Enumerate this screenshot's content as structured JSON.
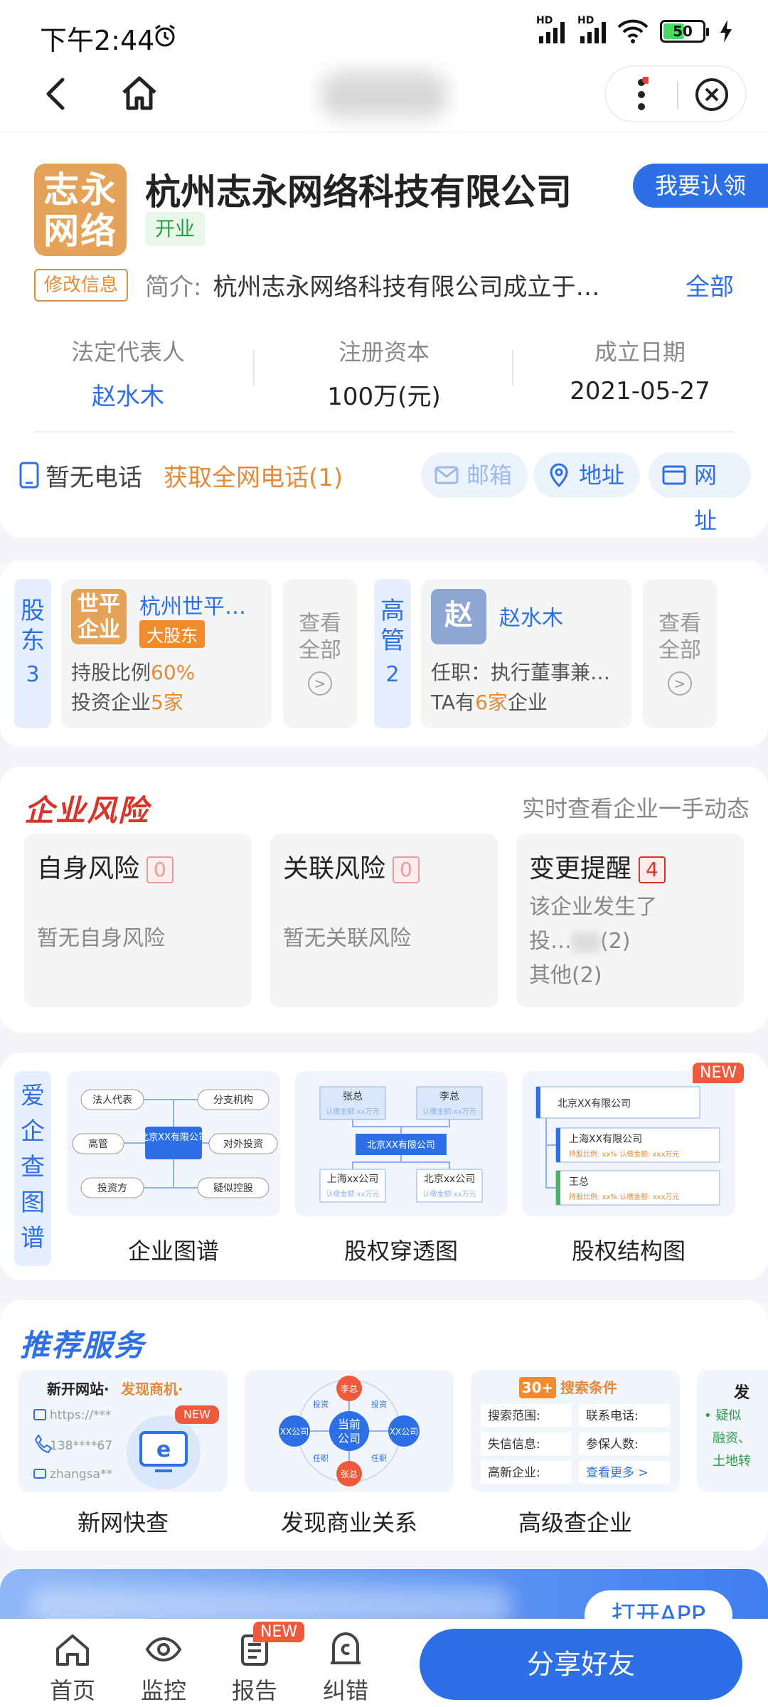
{
  "status_bar": {
    "time": "下午2:44",
    "sim1": "HD",
    "sim2": "HD",
    "battery": "50"
  },
  "company": {
    "logo_line1": "志永",
    "logo_line2": "网络",
    "name": "杭州志永网络科技有限公司",
    "status": "开业",
    "claim_label": "我要认领",
    "edit_label": "修改信息",
    "intro_label": "简介:",
    "intro_text": "杭州志永网络科技有限公司成立于…",
    "intro_all": "全部"
  },
  "key_info": [
    {
      "label": "法定代表人",
      "value": "赵水木"
    },
    {
      "label": "注册资本",
      "value": "100万(元)"
    },
    {
      "label": "成立日期",
      "value": "2021-05-27"
    }
  ],
  "contact": {
    "no_phone": "暂无电话",
    "get_phone": "获取全网电话(1)",
    "email": "邮箱",
    "address": "地址",
    "website": "网址"
  },
  "shareholders": {
    "label_top": "股",
    "label_bottom": "东",
    "count": "3",
    "avatar_line1": "世平",
    "avatar_line2": "企业",
    "name": "杭州世平…",
    "tag": "大股东",
    "ratio_label": "持股比例",
    "ratio_value": "60%",
    "invest_label": "投资企业",
    "invest_value": "5家",
    "view_all_1": "查看",
    "view_all_2": "全部"
  },
  "executives": {
    "label_top": "高",
    "label_bottom": "管",
    "count": "2",
    "avatar": "赵",
    "name": "赵水木",
    "role": "任职：执行董事兼…",
    "ta_prefix": "TA有",
    "ta_value": "6家",
    "ta_suffix": "企业",
    "view_all_1": "查看",
    "view_all_2": "全部"
  },
  "risk": {
    "title": "企业风险",
    "subtitle": "实时查看企业一手动态",
    "items": [
      {
        "title": "自身风险",
        "count": "0",
        "desc": "暂无自身风险"
      },
      {
        "title": "关联风险",
        "count": "0",
        "desc": "暂无关联风险"
      },
      {
        "title": "变更提醒",
        "count": "4",
        "line1": "该企业发生了",
        "line2a": "投…",
        "line2b": "(2)",
        "line3": "其他(2)"
      }
    ]
  },
  "graphs": {
    "label": [
      "爱",
      "企",
      "查",
      "图",
      "谱"
    ],
    "items": [
      {
        "title": "企业图谱",
        "center": "北京XX有限公司",
        "nodes": [
          "法人代表",
          "分支机构",
          "高管",
          "对外投资",
          "投资方",
          "疑似控股"
        ]
      },
      {
        "title": "股权穿透图",
        "top1": "张总",
        "top2": "李总",
        "sub": "认缴金额:xx万元",
        "center": "北京XX有限公司",
        "bottom1": "上海xx公司",
        "bottom2": "北京xx公司"
      },
      {
        "title": "股权结构图",
        "new": "NEW",
        "row1": "北京XX有限公司",
        "row2": "上海XX有限公司",
        "row3": "王总",
        "detail": "持股比例: xx%   认缴金额: xxx万元"
      }
    ]
  },
  "services": {
    "title": "推荐服务",
    "items": [
      {
        "title": "新网快查",
        "head_a": "新开网站·",
        "head_b": "发现商机·",
        "l1": "https://***",
        "l2": "138****67",
        "l3": "zhangsa**",
        "new": "NEW"
      },
      {
        "title": "发现商业关系",
        "center_a": "当前",
        "center_b": "公司",
        "top": "李总",
        "bottom": "张总",
        "left": "XX公司",
        "right": "XX公司",
        "e1": "投资",
        "e2": "投资",
        "e3": "任职",
        "e4": "任职"
      },
      {
        "title": "高级查企业",
        "head_num": "30+",
        "head_text": "搜索条件",
        "c1": "搜索范围:",
        "c2": "联系电话:",
        "c3": "失信信息:",
        "c4": "参保人数:",
        "c5": "高新企业:",
        "more": "查看更多 >"
      }
    ],
    "peek_a": "发",
    "peek_b": "• 疑似",
    "peek_c": "融资、",
    "peek_d": "土地转"
  },
  "banner": {
    "button": "打开APP"
  },
  "bottom_nav": {
    "home": "首页",
    "monitor": "监控",
    "report": "报告",
    "report_new": "NEW",
    "correct": "纠错",
    "share": "分享好友"
  }
}
